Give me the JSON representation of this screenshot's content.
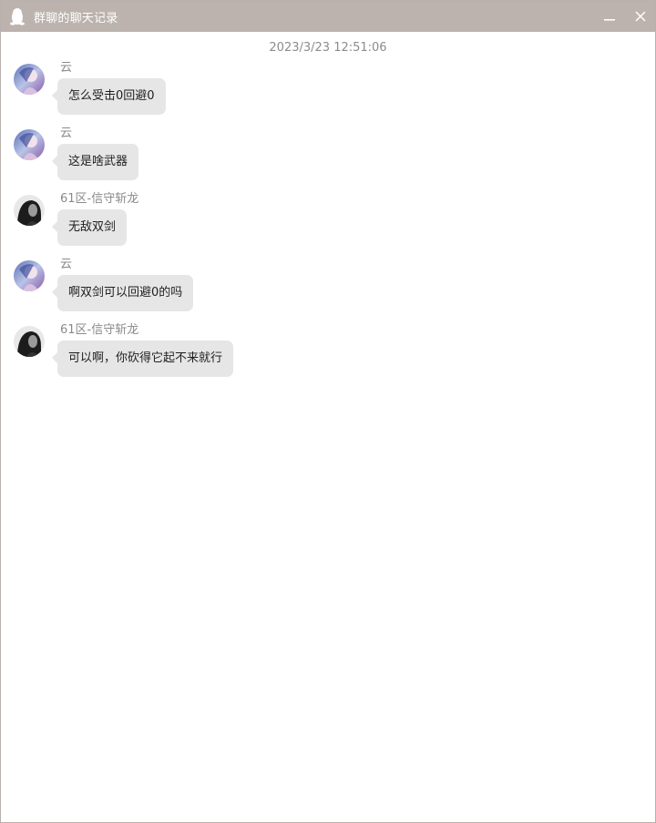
{
  "window": {
    "title": "群聊的聊天记录",
    "titlebar_color": "#bcb3ae",
    "icon": "qq-penguin-icon"
  },
  "timestamp": "2023/3/23 12:51:06",
  "messages": [
    {
      "sender": "云",
      "text": "怎么受击0回避0",
      "avatar": "avatar-yun"
    },
    {
      "sender": "云",
      "text": "这是啥武器",
      "avatar": "avatar-yun"
    },
    {
      "sender": "61区-信守斩龙",
      "text": "无敌双剑",
      "avatar": "avatar-xinshou"
    },
    {
      "sender": "云",
      "text": "啊双剑可以回避0的吗",
      "avatar": "avatar-yun"
    },
    {
      "sender": "61区-信守斩龙",
      "text": "可以啊，你砍得它起不来就行",
      "avatar": "avatar-xinshou"
    }
  ],
  "colors": {
    "bubble_bg": "#e6e6e6",
    "sender_text": "#8a8a8a"
  }
}
